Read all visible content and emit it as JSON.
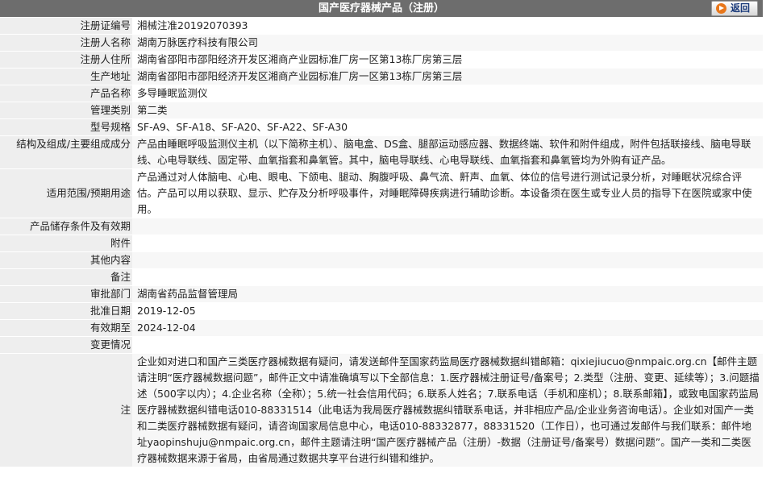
{
  "header": {
    "title": "国产医疗器械产品（注册）",
    "back_label": "返回"
  },
  "rows": [
    {
      "label": "注册证编号",
      "value": "湘械注准20192070393"
    },
    {
      "label": "注册人名称",
      "value": "湖南万脉医疗科技有限公司"
    },
    {
      "label": "注册人住所",
      "value": "湖南省邵阳市邵阳经济开发区湘商产业园标准厂房一区第13栋厂房第三层"
    },
    {
      "label": "生产地址",
      "value": "湖南省邵阳市邵阳经济开发区湘商产业园标准厂房一区第13栋厂房第三层"
    },
    {
      "label": "产品名称",
      "value": "多导睡眠监测仪"
    },
    {
      "label": "管理类别",
      "value": "第二类"
    },
    {
      "label": "型号规格",
      "value": "SF-A9、SF-A18、SF-A20、SF-A22、SF-A30"
    },
    {
      "label": "结构及组成/主要组成成分",
      "value": "产品由睡眠呼吸监测仪主机（以下简称主机）、脑电盒、DS盒、腿部运动感应器、数据终端、软件和附件组成，附件包括联接线、脑电导联线、心电导联线、固定带、血氧指套和鼻氧管。其中，脑电导联线、心电导联线、血氧指套和鼻氧管均为外购有证产品。"
    },
    {
      "label": "适用范围/预期用途",
      "value": "产品通过对人体脑电、心电、眼电、下颌电、腿动、胸腹呼吸、鼻气流、鼾声、血氧、体位的信号进行测试记录分析，对睡眠状况综合评估。产品可以用以获取、显示、贮存及分析呼吸事件，对睡眠障碍疾病进行辅助诊断。本设备须在医生或专业人员的指导下在医院或家中使用。"
    },
    {
      "label": "产品储存条件及有效期",
      "value": ""
    },
    {
      "label": "附件",
      "value": ""
    },
    {
      "label": "其他内容",
      "value": ""
    },
    {
      "label": "备注",
      "value": ""
    },
    {
      "label": "审批部门",
      "value": "湖南省药品监督管理局"
    },
    {
      "label": "批准日期",
      "value": "2019-12-05"
    },
    {
      "label": "有效期至",
      "value": "2024-12-04"
    },
    {
      "label": "变更情况",
      "value": ""
    },
    {
      "label": "注",
      "value": "企业如对进口和国产三类医疗器械数据有疑问，请发送邮件至国家药监局医疗器械数据纠错邮箱：qixiejiucuo@nmpaic.org.cn【邮件主题请注明“医疗器械数据问题”，邮件正文中请准确填写以下全部信息：1.医疗器械注册证号/备案号；2.类型（注册、变更、延续等）；3.问题描述（500字以内）；4.企业名称（全称）；5.统一社会信用代码；6.联系人姓名；7.联系电话（手机和座机）；8.联系邮箱】，或致电国家药监局医疗器械数据纠错电话010-88331514（此电话为我局医疗器械数据纠错联系电话，并非相应产品/企业业务咨询电话）。企业如对国产一类和二类医疗器械数据有疑问，请咨询国家局信息中心，电话010-88332877，88331520（工作日），也可通过发邮件与我们联系：邮件地址yaopinshuju@nmpaic.org.cn，邮件主题请注明“国产医疗器械产品（注册）-数据（注册证号/备案号）数据问题”。国产一类和二类医疗器械数据来源于省局，由省局通过数据共享平台进行纠错和维护。"
    }
  ]
}
